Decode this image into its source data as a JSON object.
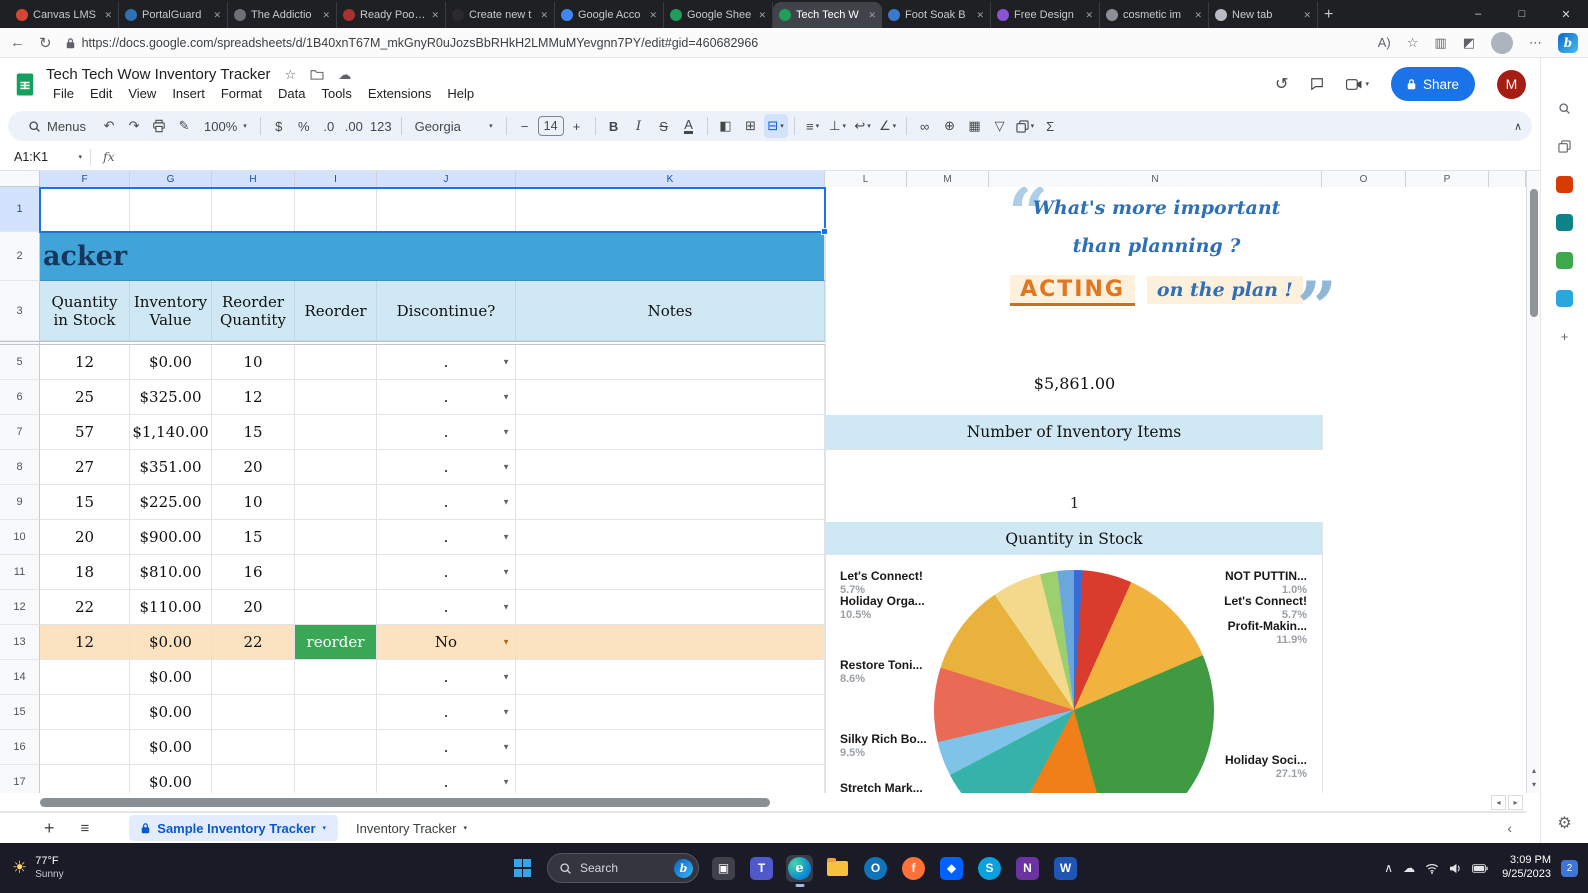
{
  "browser": {
    "tabs": [
      {
        "label": "Canvas LMS",
        "color": "#d64534",
        "active": false
      },
      {
        "label": "PortalGuard",
        "color": "#2f6fb3",
        "active": false
      },
      {
        "label": "The Addictio",
        "color": "#6b6f76",
        "active": false
      },
      {
        "label": "Ready Pool V",
        "color": "#a83232",
        "active": false
      },
      {
        "label": "Create new t",
        "color": "#2b2b2b",
        "active": false
      },
      {
        "label": "Google Acco",
        "color": "#4285f4",
        "active": false
      },
      {
        "label": "Google Shee",
        "color": "#1e9e5a",
        "active": false
      },
      {
        "label": "Tech Tech W",
        "color": "#1e9e5a",
        "active": true
      },
      {
        "label": "Foot Soak B",
        "color": "#3a78c9",
        "active": false
      },
      {
        "label": "Free Design",
        "color": "#8b53d6",
        "active": false
      },
      {
        "label": "cosmetic im",
        "color": "#8a8f98",
        "active": false
      },
      {
        "label": "New tab",
        "color": "#b7bcc4",
        "active": false
      }
    ],
    "new_tab_button": "+",
    "close_glyph": "✕",
    "window_controls": {
      "minimize": "–",
      "maximize": "□",
      "close": "✕"
    },
    "back_glyph": "←",
    "refresh_glyph": "↻",
    "url": "https://docs.google.com/spreadsheets/d/1B40xnT67M_mkGnyR0uJozsBbRHkH2LMMuMYevgnn7PY/edit#gid=460682966",
    "nav_icons": [
      {
        "name": "read-aloud-icon",
        "glyph": "A)"
      },
      {
        "name": "favorites-icon",
        "glyph": "☆"
      },
      {
        "name": "split-screen-icon",
        "glyph": "▥"
      },
      {
        "name": "extensions-icon",
        "glyph": "◩"
      },
      {
        "name": "more-menu-icon",
        "glyph": "⋯"
      }
    ]
  },
  "sheets": {
    "title": "Tech Tech Wow Inventory Tracker",
    "menus": [
      "File",
      "Edit",
      "View",
      "Insert",
      "Format",
      "Data",
      "Tools",
      "Extensions",
      "Help"
    ],
    "share_label": "Share",
    "avatar_initial": "M",
    "collapse_glyph": "∧",
    "toolbar_items": [
      {
        "kind": "menus",
        "name": "menus-button",
        "label": "Menus"
      },
      {
        "kind": "glyph",
        "name": "undo-icon",
        "glyph": "↶"
      },
      {
        "kind": "glyph",
        "name": "redo-icon",
        "glyph": "↷"
      },
      {
        "kind": "svg",
        "name": "print-icon",
        "svg": "printer"
      },
      {
        "kind": "glyph",
        "name": "paint-format-icon",
        "glyph": "✎"
      },
      {
        "kind": "select",
        "name": "zoom-select",
        "label": "100%"
      },
      {
        "kind": "sep"
      },
      {
        "kind": "glyph",
        "name": "format-currency-icon",
        "glyph": "$"
      },
      {
        "kind": "glyph",
        "name": "format-percent-icon",
        "glyph": "%"
      },
      {
        "kind": "glyph",
        "name": "decrease-decimal-icon",
        "glyph": ".0"
      },
      {
        "kind": "glyph",
        "name": "increase-decimal-icon",
        "glyph": ".00"
      },
      {
        "kind": "glyph",
        "name": "more-formats-icon",
        "glyph": "123"
      },
      {
        "kind": "sep"
      },
      {
        "kind": "select",
        "name": "font-select",
        "label": "Georgia",
        "wide": true
      },
      {
        "kind": "sep"
      },
      {
        "kind": "glyph",
        "name": "decrease-font-size-icon",
        "glyph": "−"
      },
      {
        "kind": "box",
        "name": "font-size-input",
        "label": "14"
      },
      {
        "kind": "glyph",
        "name": "increase-font-size-icon",
        "glyph": "+"
      },
      {
        "kind": "sep"
      },
      {
        "kind": "glyph",
        "name": "bold-icon",
        "glyph": "B",
        "cls": "g-b"
      },
      {
        "kind": "glyph",
        "name": "italic-icon",
        "glyph": "I",
        "cls": "g-i"
      },
      {
        "kind": "glyph",
        "name": "strikethrough-icon",
        "glyph": "S",
        "cls": "g-s"
      },
      {
        "kind": "glyph",
        "name": "text-color-icon",
        "glyph": "A",
        "cls": "g-ua"
      },
      {
        "kind": "sep"
      },
      {
        "kind": "glyph",
        "name": "fill-color-icon",
        "glyph": "◧"
      },
      {
        "kind": "glyph",
        "name": "borders-icon",
        "glyph": "⊞"
      },
      {
        "kind": "glyph",
        "name": "merge-cells-icon",
        "glyph": "⊟",
        "caret": true,
        "active": true
      },
      {
        "kind": "sep"
      },
      {
        "kind": "glyph",
        "name": "horizontal-align-icon",
        "glyph": "≡",
        "caret": true
      },
      {
        "kind": "glyph",
        "name": "vertical-align-icon",
        "glyph": "⊥",
        "caret": true
      },
      {
        "kind": "glyph",
        "name": "text-wrap-icon",
        "glyph": "↩",
        "caret": true
      },
      {
        "kind": "glyph",
        "name": "text-rotation-icon",
        "glyph": "∠",
        "caret": true
      },
      {
        "kind": "sep"
      },
      {
        "kind": "glyph",
        "name": "insert-link-icon",
        "glyph": "∞"
      },
      {
        "kind": "glyph",
        "name": "insert-comment-icon",
        "glyph": "⊕"
      },
      {
        "kind": "glyph",
        "name": "insert-chart-icon",
        "glyph": "▦"
      },
      {
        "kind": "glyph",
        "name": "create-filter-icon",
        "glyph": "▽"
      },
      {
        "kind": "svg",
        "name": "table-views-icon",
        "svg": "layers",
        "caret": true
      },
      {
        "kind": "glyph",
        "name": "functions-icon",
        "glyph": "Σ"
      }
    ],
    "formula_bar": {
      "name_box": "A1:K1",
      "fx": "fx"
    },
    "grid": {
      "columns": [
        "F",
        "G",
        "H",
        "I",
        "J",
        "K",
        "L",
        "M",
        "N",
        "O",
        "P"
      ],
      "selected_columns": [
        "F",
        "G",
        "H",
        "I",
        "J",
        "K"
      ],
      "title_fragment": "acker",
      "header_cells": [
        "Quantity in Stock",
        "Inventory Value",
        "Reorder Quantity",
        "Reorder",
        "Discontinue?",
        "Notes"
      ],
      "rows": [
        {
          "type": "selected",
          "n": "1"
        },
        {
          "type": "title",
          "n": "2"
        },
        {
          "type": "header",
          "n": "3"
        },
        {
          "type": "divider"
        },
        {
          "type": "data",
          "n": "5",
          "f": "12",
          "g": "$0.00",
          "h": "10",
          "i": "",
          "j": "."
        },
        {
          "type": "data",
          "n": "6",
          "f": "25",
          "g": "$325.00",
          "h": "12",
          "i": "",
          "j": "."
        },
        {
          "type": "data",
          "n": "7",
          "f": "57",
          "g": "$1,140.00",
          "h": "15",
          "i": "",
          "j": "."
        },
        {
          "type": "data",
          "n": "8",
          "f": "27",
          "g": "$351.00",
          "h": "20",
          "i": "",
          "j": "."
        },
        {
          "type": "data",
          "n": "9",
          "f": "15",
          "g": "$225.00",
          "h": "10",
          "i": "",
          "j": "."
        },
        {
          "type": "data",
          "n": "10",
          "f": "20",
          "g": "$900.00",
          "h": "15",
          "i": "",
          "j": "."
        },
        {
          "type": "data",
          "n": "11",
          "f": "18",
          "g": "$810.00",
          "h": "16",
          "i": "",
          "j": "."
        },
        {
          "type": "data",
          "n": "12",
          "f": "22",
          "g": "$110.00",
          "h": "20",
          "i": "",
          "j": "."
        },
        {
          "type": "data",
          "n": "13",
          "f": "12",
          "g": "$0.00",
          "h": "22",
          "i": "reorder",
          "j": "No",
          "highlight": true
        },
        {
          "type": "data",
          "n": "14",
          "f": "",
          "g": "$0.00",
          "h": "",
          "i": "",
          "j": "."
        },
        {
          "type": "data",
          "n": "15",
          "f": "",
          "g": "$0.00",
          "h": "",
          "i": "",
          "j": "."
        },
        {
          "type": "data",
          "n": "16",
          "f": "",
          "g": "$0.00",
          "h": "",
          "i": "",
          "j": "."
        },
        {
          "type": "data",
          "n": "17",
          "f": "",
          "g": "$0.00",
          "h": "",
          "i": "",
          "j": "."
        }
      ]
    },
    "right_panel": {
      "quote": {
        "open_mark": "“",
        "close_mark": "”",
        "line1": "What's more important",
        "line2": "than planning ?",
        "emphasis": "ACTING",
        "line3": "on the plan !"
      },
      "total_value": "$5,861.00",
      "items_banner": "Number of Inventory Items",
      "items_count": "1",
      "qty_banner": "Quantity in Stock",
      "callouts_left": [
        {
          "label": "Let's Connect!",
          "pct": "5.7%"
        },
        {
          "label": "Holiday Orga...",
          "pct": "10.5%"
        },
        {
          "label": "Restore Toni...",
          "pct": "8.6%"
        },
        {
          "label": "Silky Rich Bo...",
          "pct": "9.5%"
        },
        {
          "label": "Stretch Mark...",
          "pct": ""
        }
      ],
      "callouts_right": [
        {
          "label": "NOT PUTTIN...",
          "pct": "1.0%"
        },
        {
          "label": "Let's Connect!",
          "pct": "5.7%"
        },
        {
          "label": "Profit-Makin...",
          "pct": "11.9%"
        },
        {
          "label": "Holiday Soci...",
          "pct": "27.1%"
        }
      ]
    },
    "sheet_tabs": [
      {
        "label": "Sample Inventory Tracker",
        "active": true,
        "protected": true
      },
      {
        "label": "Inventory Tracker",
        "active": false,
        "protected": false
      }
    ]
  },
  "chart_data": {
    "type": "pie",
    "title": "Quantity in Stock",
    "legend_position": "outside-callouts",
    "slices": [
      {
        "label": "NOT PUTTIN...",
        "pct": 1.0,
        "color": "#3b6bd6"
      },
      {
        "label": "Let's Connect!",
        "pct": 5.7,
        "color": "#d93c2c"
      },
      {
        "label": "Profit-Makin...",
        "pct": 11.9,
        "color": "#f2b23e"
      },
      {
        "label": "Holiday Soci...",
        "pct": 27.1,
        "color": "#3f9a41"
      },
      {
        "label": "Stretch Mark...",
        "pct": 12.1,
        "color": "#f07f1a"
      },
      {
        "label": "Silky Rich Bo...",
        "pct": 9.5,
        "color": "#36b3a8"
      },
      {
        "label": "",
        "pct": 4.0,
        "color": "#7fc4e8"
      },
      {
        "label": "Restore Toni...",
        "pct": 8.6,
        "color": "#e96a55"
      },
      {
        "label": "Holiday Orga...",
        "pct": 10.5,
        "color": "#e9b23c"
      },
      {
        "label": "Let's Connect!",
        "pct": 5.7,
        "color": "#f3d98b"
      },
      {
        "label": "",
        "pct": 2.0,
        "color": "#9ccf6e"
      },
      {
        "label": "",
        "pct": 1.9,
        "color": "#6aa7dd"
      }
    ]
  },
  "taskbar": {
    "weather_temp": "77°F",
    "weather_cond": "Sunny",
    "search_label": "Search",
    "apps": [
      {
        "name": "app-icon-taskview",
        "bg": "#3f4049",
        "glyph": "▣",
        "shape": "sq",
        "active": false
      },
      {
        "name": "app-icon-teams",
        "bg": "#5059c9",
        "glyph": "T",
        "shape": "sq",
        "active": false
      },
      {
        "name": "app-icon-edge",
        "bg": "",
        "glyph": "e",
        "shape": "edge",
        "active": true
      },
      {
        "name": "app-icon-file-explorer",
        "bg": "",
        "glyph": "",
        "shape": "folder",
        "active": false
      },
      {
        "name": "app-icon-outlook",
        "bg": "#1273b8",
        "glyph": "O",
        "shape": "circle",
        "active": false
      },
      {
        "name": "app-icon-firefox",
        "bg": "#ff7139",
        "glyph": "f",
        "shape": "circle",
        "active": false
      },
      {
        "name": "app-icon-dropbox",
        "bg": "#0061fe",
        "glyph": "◆",
        "shape": "sq",
        "active": false
      },
      {
        "name": "app-icon-skype",
        "bg": "#0aa1dc",
        "glyph": "S",
        "shape": "circle",
        "active": false
      },
      {
        "name": "app-icon-onenote",
        "bg": "#6a33a0",
        "glyph": "N",
        "shape": "sq",
        "active": false
      },
      {
        "name": "app-icon-word",
        "bg": "#1f56b5",
        "glyph": "W",
        "shape": "sq",
        "active": false
      }
    ],
    "tray_chevron": "∧",
    "time": "3:09 PM",
    "date": "9/25/2023",
    "badge": "2"
  },
  "sidebar": {
    "icons": [
      {
        "name": "sidebar-search-icon",
        "kind": "svg",
        "svg": "magnifier"
      },
      {
        "name": "sidebar-layers-icon",
        "kind": "svg",
        "svg": "layers"
      },
      {
        "name": "sidebar-office-icon",
        "kind": "dot",
        "bg": "#d83b01"
      },
      {
        "name": "sidebar-outlook-icon",
        "kind": "dot",
        "bg": "#0f8387"
      },
      {
        "name": "sidebar-designer-icon",
        "kind": "dot",
        "bg": "#3fa74c"
      },
      {
        "name": "sidebar-drop-icon",
        "kind": "dot",
        "bg": "#2aa7de"
      },
      {
        "name": "sidebar-add-icon",
        "kind": "glyph",
        "glyph": "+"
      }
    ],
    "settings_glyph": "⚙"
  }
}
